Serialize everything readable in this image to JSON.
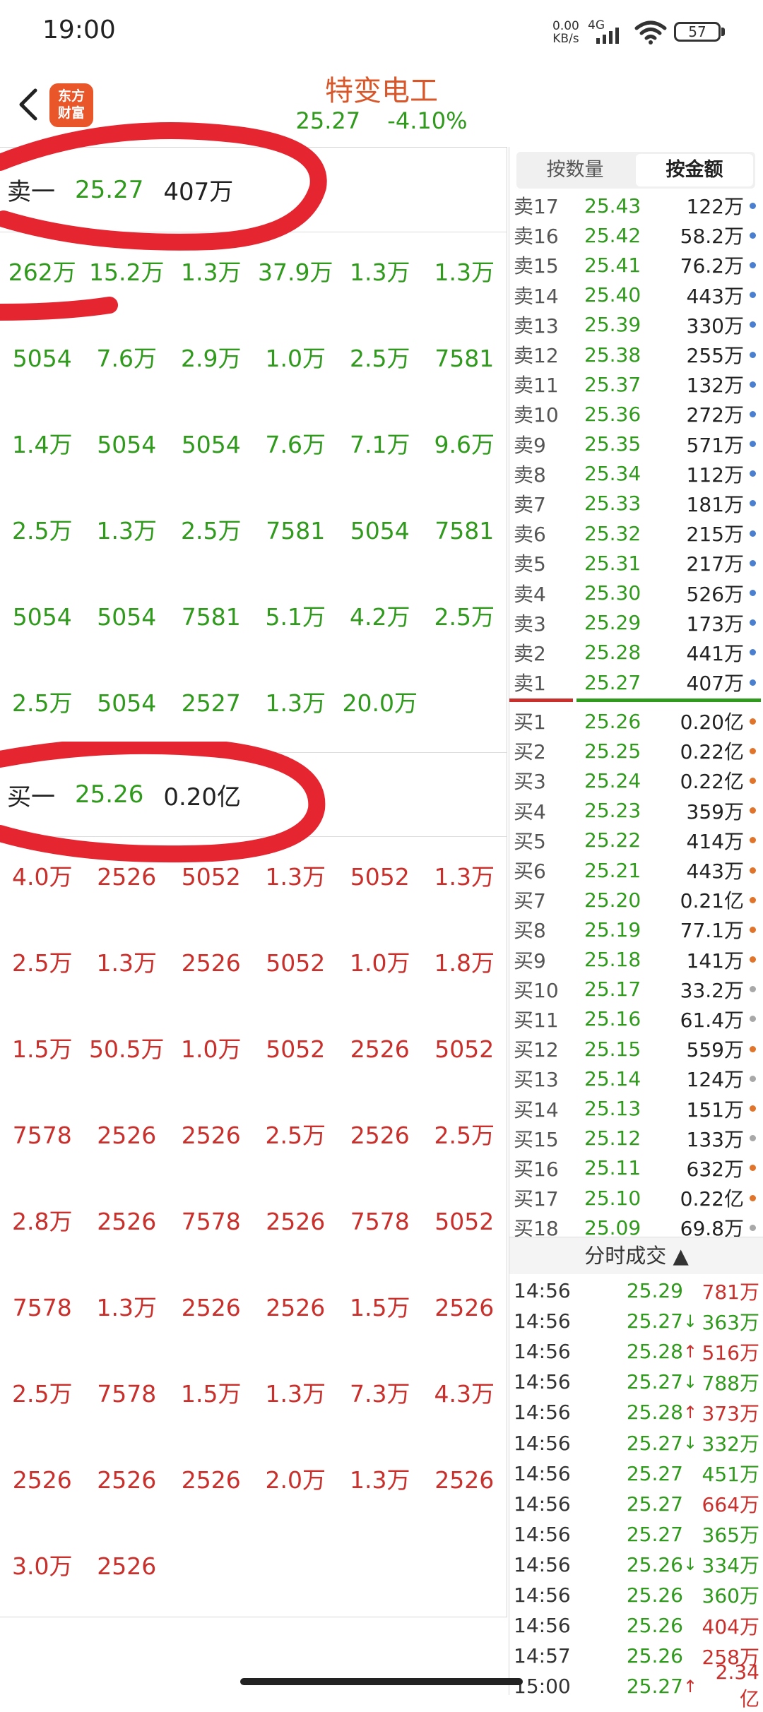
{
  "status_bar": {
    "time": "19:00",
    "net_speed_value": "0.00",
    "net_speed_unit": "KB/s",
    "network": "4G",
    "battery": "57"
  },
  "header": {
    "logo_line1": "东方",
    "logo_line2": "财富",
    "stock_name": "特变电工",
    "price": "25.27",
    "change_pct": "-4.10%"
  },
  "ask1": {
    "label": "卖一",
    "price": "25.27",
    "volume": "407万"
  },
  "ask1_orders": [
    "262万",
    "15.2万",
    "1.3万",
    "37.9万",
    "1.3万",
    "1.3万",
    "5054",
    "7.6万",
    "2.9万",
    "1.0万",
    "2.5万",
    "7581",
    "1.4万",
    "5054",
    "5054",
    "7.6万",
    "7.1万",
    "9.6万",
    "2.5万",
    "1.3万",
    "2.5万",
    "7581",
    "5054",
    "7581",
    "5054",
    "5054",
    "7581",
    "5.1万",
    "4.2万",
    "2.5万",
    "2.5万",
    "5054",
    "2527",
    "1.3万",
    "20.0万"
  ],
  "bid1": {
    "label": "买一",
    "price": "25.26",
    "volume": "0.20亿"
  },
  "bid1_orders": [
    "4.0万",
    "2526",
    "5052",
    "1.3万",
    "5052",
    "1.3万",
    "2.5万",
    "1.3万",
    "2526",
    "5052",
    "1.0万",
    "1.8万",
    "1.5万",
    "50.5万",
    "1.0万",
    "5052",
    "2526",
    "5052",
    "7578",
    "2526",
    "2526",
    "2.5万",
    "2526",
    "2.5万",
    "2.8万",
    "2526",
    "7578",
    "2526",
    "7578",
    "5052",
    "7578",
    "1.3万",
    "2526",
    "2526",
    "1.5万",
    "2526",
    "2.5万",
    "7578",
    "1.5万",
    "1.3万",
    "7.3万",
    "4.3万",
    "2526",
    "2526",
    "2526",
    "2.0万",
    "1.3万",
    "2526",
    "3.0万",
    "2526"
  ],
  "mode_tabs": {
    "by_quantity": "按数量",
    "by_amount": "按金额"
  },
  "asks": [
    {
      "label": "卖17",
      "price": "25.43",
      "volume": "122万"
    },
    {
      "label": "卖16",
      "price": "25.42",
      "volume": "58.2万"
    },
    {
      "label": "卖15",
      "price": "25.41",
      "volume": "76.2万"
    },
    {
      "label": "卖14",
      "price": "25.40",
      "volume": "443万"
    },
    {
      "label": "卖13",
      "price": "25.39",
      "volume": "330万"
    },
    {
      "label": "卖12",
      "price": "25.38",
      "volume": "255万"
    },
    {
      "label": "卖11",
      "price": "25.37",
      "volume": "132万"
    },
    {
      "label": "卖10",
      "price": "25.36",
      "volume": "272万"
    },
    {
      "label": "卖9",
      "price": "25.35",
      "volume": "571万"
    },
    {
      "label": "卖8",
      "price": "25.34",
      "volume": "112万"
    },
    {
      "label": "卖7",
      "price": "25.33",
      "volume": "181万"
    },
    {
      "label": "卖6",
      "price": "25.32",
      "volume": "215万"
    },
    {
      "label": "卖5",
      "price": "25.31",
      "volume": "217万"
    },
    {
      "label": "卖4",
      "price": "25.30",
      "volume": "526万"
    },
    {
      "label": "卖3",
      "price": "25.29",
      "volume": "173万"
    },
    {
      "label": "卖2",
      "price": "25.28",
      "volume": "441万"
    },
    {
      "label": "卖1",
      "price": "25.27",
      "volume": "407万"
    }
  ],
  "bids": [
    {
      "label": "买1",
      "price": "25.26",
      "volume": "0.20亿",
      "dot": "orange"
    },
    {
      "label": "买2",
      "price": "25.25",
      "volume": "0.22亿",
      "dot": "orange"
    },
    {
      "label": "买3",
      "price": "25.24",
      "volume": "0.22亿",
      "dot": "orange"
    },
    {
      "label": "买4",
      "price": "25.23",
      "volume": "359万",
      "dot": "orange"
    },
    {
      "label": "买5",
      "price": "25.22",
      "volume": "414万",
      "dot": "orange"
    },
    {
      "label": "买6",
      "price": "25.21",
      "volume": "443万",
      "dot": "orange"
    },
    {
      "label": "买7",
      "price": "25.20",
      "volume": "0.21亿",
      "dot": "orange"
    },
    {
      "label": "买8",
      "price": "25.19",
      "volume": "77.1万",
      "dot": "orange"
    },
    {
      "label": "买9",
      "price": "25.18",
      "volume": "141万",
      "dot": "orange"
    },
    {
      "label": "买10",
      "price": "25.17",
      "volume": "33.2万",
      "dot": "gray"
    },
    {
      "label": "买11",
      "price": "25.16",
      "volume": "61.4万",
      "dot": "gray"
    },
    {
      "label": "买12",
      "price": "25.15",
      "volume": "559万",
      "dot": "orange"
    },
    {
      "label": "买13",
      "price": "25.14",
      "volume": "124万",
      "dot": "gray"
    },
    {
      "label": "买14",
      "price": "25.13",
      "volume": "151万",
      "dot": "orange"
    },
    {
      "label": "买15",
      "price": "25.12",
      "volume": "133万",
      "dot": "gray"
    },
    {
      "label": "买16",
      "price": "25.11",
      "volume": "632万",
      "dot": "orange"
    },
    {
      "label": "买17",
      "price": "25.10",
      "volume": "0.22亿",
      "dot": "orange"
    },
    {
      "label": "买18",
      "price": "25.09",
      "volume": "69.8万",
      "dot": "gray"
    }
  ],
  "ticks_title": "分时成交",
  "ticks": [
    {
      "time": "14:56",
      "price": "25.29",
      "arrow": "",
      "volume": "781万",
      "color": "red"
    },
    {
      "time": "14:56",
      "price": "25.27",
      "arrow": "↓",
      "volume": "363万",
      "color": "green"
    },
    {
      "time": "14:56",
      "price": "25.28",
      "arrow": "↑",
      "volume": "516万",
      "color": "red"
    },
    {
      "time": "14:56",
      "price": "25.27",
      "arrow": "↓",
      "volume": "788万",
      "color": "green"
    },
    {
      "time": "14:56",
      "price": "25.28",
      "arrow": "↑",
      "volume": "373万",
      "color": "red"
    },
    {
      "time": "14:56",
      "price": "25.27",
      "arrow": "↓",
      "volume": "332万",
      "color": "green"
    },
    {
      "time": "14:56",
      "price": "25.27",
      "arrow": "",
      "volume": "451万",
      "color": "green"
    },
    {
      "time": "14:56",
      "price": "25.27",
      "arrow": "",
      "volume": "664万",
      "color": "red"
    },
    {
      "time": "14:56",
      "price": "25.27",
      "arrow": "",
      "volume": "365万",
      "color": "green"
    },
    {
      "time": "14:56",
      "price": "25.26",
      "arrow": "↓",
      "volume": "334万",
      "color": "green"
    },
    {
      "time": "14:56",
      "price": "25.26",
      "arrow": "",
      "volume": "360万",
      "color": "green"
    },
    {
      "time": "14:56",
      "price": "25.26",
      "arrow": "",
      "volume": "404万",
      "color": "red"
    },
    {
      "time": "14:57",
      "price": "25.26",
      "arrow": "",
      "volume": "258万",
      "color": "red"
    },
    {
      "time": "15:00",
      "price": "25.27",
      "arrow": "↑",
      "volume": "2.34亿",
      "color": "red"
    }
  ],
  "colors": {
    "green": "#2f9a1c",
    "red": "#c9302c",
    "blue_dot": "#4a7fd0",
    "orange_dot": "#e0742a",
    "gray_dot": "#a8a8a8",
    "annotation": "#e52630"
  }
}
